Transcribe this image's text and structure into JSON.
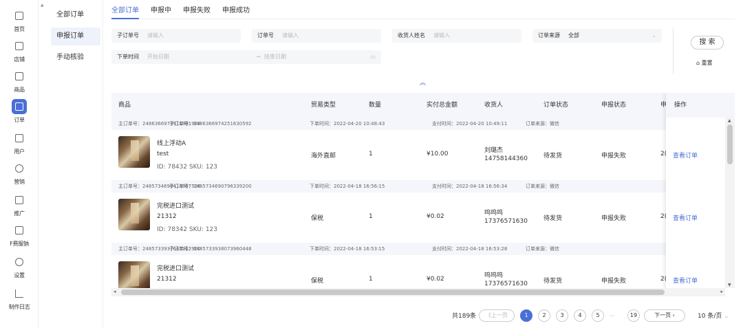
{
  "rail": [
    {
      "label": "首页",
      "icon": "home-icon"
    },
    {
      "label": "店铺",
      "icon": "store-icon"
    },
    {
      "label": "商品",
      "icon": "goods-icon"
    },
    {
      "label": "订单",
      "icon": "order-icon",
      "active": true
    },
    {
      "label": "用户",
      "icon": "user-icon"
    },
    {
      "label": "营销",
      "icon": "marketing-icon"
    },
    {
      "label": "推广",
      "icon": "promote-icon"
    },
    {
      "label": "F费服钠",
      "icon": "fee-icon"
    },
    {
      "label": "设置",
      "icon": "settings-icon"
    },
    {
      "label": "制作日志",
      "icon": "log-icon"
    }
  ],
  "submenu": [
    "全部订单",
    "申报订单",
    "手动核验"
  ],
  "tabs": [
    "全部订单",
    "申报中",
    "申报失败",
    "申报成功"
  ],
  "filters": {
    "sub_order_label": "子订单号",
    "sub_order_ph": "请输入",
    "order_label": "订单号",
    "order_ph": "请输入",
    "receiver_label": "收货人姓名",
    "receiver_ph": "请输入",
    "source_label": "订单来源",
    "source_value": "全部",
    "time_label": "下单时间",
    "start_ph": "开始日期",
    "range_sep": "→",
    "end_ph": "结束日期",
    "search_label": "搜 索",
    "reset_label": "重置"
  },
  "table": {
    "headers": [
      "商品",
      "贸易类型",
      "数量",
      "实付总金额",
      "收货人",
      "订单状态",
      "申报状态",
      "申",
      "操作"
    ],
    "orders": [
      {
        "main": "主订单号：2486366973911891968",
        "sub": "子订单号：1486366974251630592",
        "order_time": "下单时间：2022-04-20 10:48:43",
        "pay_time": "支付时间：2022-04-20 10:49:11",
        "source": "订单来源：微信",
        "name": "线上浮动A",
        "code": "test",
        "ids": "ID: 78432  SKU: 123",
        "trade": "海外直邮",
        "qty": "1",
        "amount": "¥10.00",
        "receiver": "刘璐杰",
        "phone": "14758144360",
        "status": "待发货",
        "declare": "申报失败",
        "extra": "2(",
        "action": "查看订单"
      },
      {
        "main": "主订单号：2485734690414657536",
        "sub": "子订单号：1485734690796339200",
        "order_time": "下单时间：2022-04-18 16:56:15",
        "pay_time": "支付时间：2022-04-18 16:56:34",
        "source": "订单来源：微信",
        "name": "完税进口测试",
        "code": "21312",
        "ids": "ID: 78342  SKU: 123",
        "trade": "保税",
        "qty": "1",
        "amount": "¥0.02",
        "receiver": "呜呜呜",
        "phone": "17376571630",
        "status": "待发货",
        "declare": "申报失败",
        "extra": "2(",
        "action": "查看订单"
      },
      {
        "main": "主订单号：2485733937667112960",
        "sub": "子订单号：1485733938073960448",
        "order_time": "下单时间：2022-04-18 16:53:15",
        "pay_time": "支付时间：2022-04-18 16:53:28",
        "source": "订单来源：微信",
        "name": "完税进口测试",
        "code": "21312",
        "ids": "",
        "trade": "保税",
        "qty": "1",
        "amount": "¥0.02",
        "receiver": "呜呜呜",
        "phone": "17376571630",
        "status": "待发货",
        "declare": "申报失败",
        "extra": "2(",
        "action": "查看订单"
      }
    ]
  },
  "pager": {
    "total": "共189条",
    "prev": "《上一页",
    "pages": [
      "1",
      "2",
      "3",
      "4",
      "5",
      "···",
      "19"
    ],
    "next": "下一页 ›",
    "size": "10 条/页"
  },
  "accent": "#4a6fd6"
}
